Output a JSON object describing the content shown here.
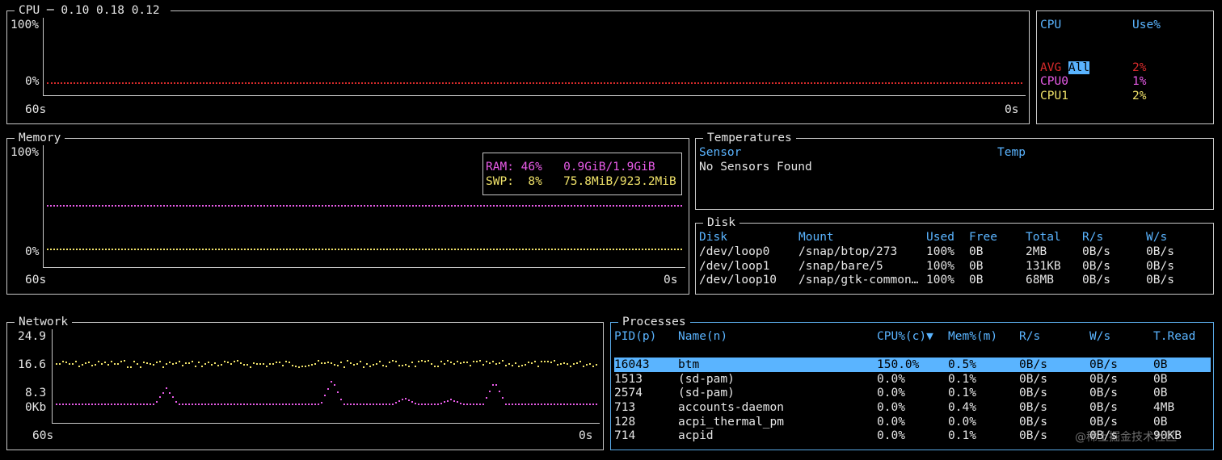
{
  "cpu": {
    "title": "CPU",
    "load": "0.10 0.18 0.12",
    "y_top": "100%",
    "y_bottom": "0%",
    "x_left": "60s",
    "x_right": "0s",
    "colors": {
      "avg": "#d92b2b"
    }
  },
  "cpu_list": {
    "col_cpu": "CPU",
    "col_use": "Use%",
    "rows": [
      {
        "name": "All",
        "use": ""
      },
      {
        "name": "AVG",
        "use": "2%"
      },
      {
        "name": "CPU0",
        "use": "1%"
      },
      {
        "name": "CPU1",
        "use": "2%"
      }
    ]
  },
  "memory": {
    "title": "Memory",
    "y_top": "100%",
    "y_bottom": "0%",
    "x_left": "60s",
    "x_right": "0s",
    "ram_label": "RAM:",
    "ram_pct": "46%",
    "ram_used": "0.9GiB/1.9GiB",
    "swp_label": "SWP:",
    "swp_pct": "8%",
    "swp_used": "75.8MiB/923.2MiB",
    "ram_fraction": 0.46,
    "swp_fraction": 0.08
  },
  "temperatures": {
    "title": "Temperatures",
    "col_sensor": "Sensor",
    "col_temp": "Temp",
    "message": "No Sensors Found"
  },
  "disk": {
    "title": "Disk",
    "headers": [
      "Disk",
      "Mount",
      "Used",
      "Free",
      "Total",
      "R/s",
      "W/s"
    ],
    "rows": [
      [
        "/dev/loop0",
        "/snap/btop/273",
        "100%",
        "0B",
        "2MB",
        "0B/s",
        "0B/s"
      ],
      [
        "/dev/loop1",
        "/snap/bare/5",
        "100%",
        "0B",
        "131KB",
        "0B/s",
        "0B/s"
      ],
      [
        "/dev/loop10",
        "/snap/gtk-common…",
        "100%",
        "0B",
        "68MB",
        "0B/s",
        "0B/s"
      ]
    ]
  },
  "network": {
    "title": "Network",
    "y_labels": [
      "24.9",
      "16.6",
      "8.3",
      "0Kb"
    ],
    "x_left": "60s",
    "x_right": "0s"
  },
  "processes": {
    "title": "Processes",
    "headers": [
      "PID(p)",
      "Name(n)",
      "CPU%(c)▼",
      "Mem%(m)",
      "R/s",
      "W/s",
      "T.Read"
    ],
    "rows": [
      [
        "16043",
        "btm",
        "150.0%",
        "0.5%",
        "0B/s",
        "0B/s",
        "0B"
      ],
      [
        "1513",
        "(sd-pam)",
        "0.0%",
        "0.1%",
        "0B/s",
        "0B/s",
        "0B"
      ],
      [
        "2574",
        "(sd-pam)",
        "0.0%",
        "0.1%",
        "0B/s",
        "0B/s",
        "0B"
      ],
      [
        "713",
        "accounts-daemon",
        "0.0%",
        "0.4%",
        "0B/s",
        "0B/s",
        "4MB"
      ],
      [
        "128",
        "acpi_thermal_pm",
        "0.0%",
        "0.0%",
        "0B/s",
        "0B/s",
        "0B"
      ],
      [
        "714",
        "acpid",
        "0.0%",
        "0.1%",
        "0B/s",
        "0B/s",
        "90KB"
      ]
    ]
  },
  "watermark": "@稀土掘金技术社区"
}
